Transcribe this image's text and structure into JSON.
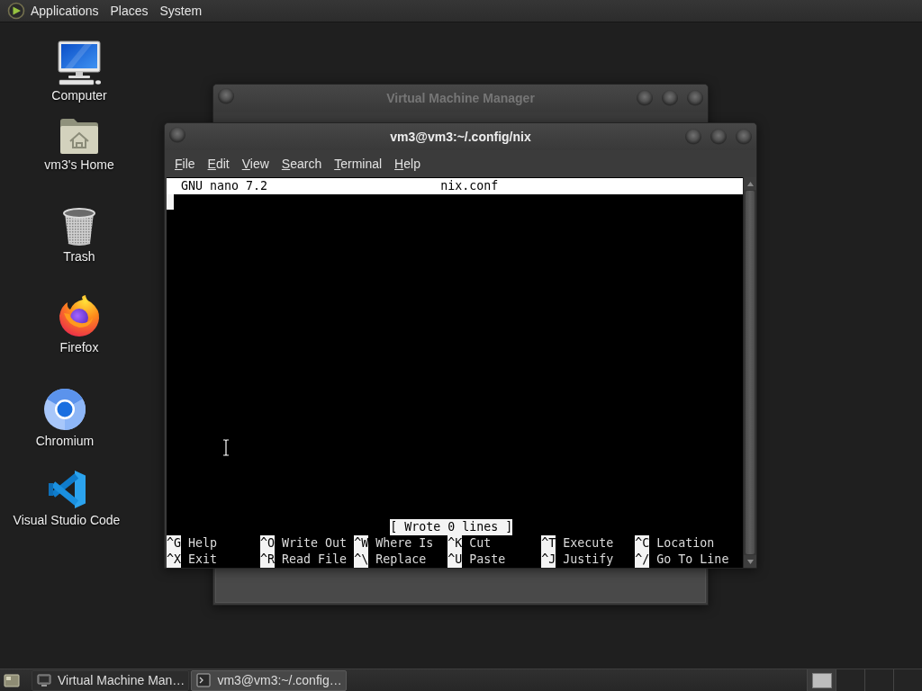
{
  "top_panel": {
    "menus": [
      "Applications",
      "Places",
      "System"
    ]
  },
  "desktop_icons": [
    {
      "kind": "computer",
      "label": "Computer"
    },
    {
      "kind": "home",
      "label": "vm3's Home"
    },
    {
      "kind": "trash",
      "label": "Trash"
    },
    {
      "kind": "firefox",
      "label": "Firefox"
    },
    {
      "kind": "chromium",
      "label": "Chromium"
    },
    {
      "kind": "vscode",
      "label": "Visual Studio Code"
    }
  ],
  "windows": [
    {
      "title": "Virtual Machine Manager",
      "focused": false
    },
    {
      "title": "vm3@vm3:~/.config/nix",
      "focused": true,
      "menus": [
        "File",
        "Edit",
        "View",
        "Search",
        "Terminal",
        "Help"
      ],
      "nano": {
        "version": "GNU nano 7.2",
        "filename": "nix.conf",
        "status": "[ Wrote 0 lines ]",
        "shortcut_rows": [
          [
            {
              "key": "^G",
              "label": "Help"
            },
            {
              "key": "^O",
              "label": "Write Out"
            },
            {
              "key": "^W",
              "label": "Where Is"
            },
            {
              "key": "^K",
              "label": "Cut"
            },
            {
              "key": "^T",
              "label": "Execute"
            },
            {
              "key": "^C",
              "label": "Location"
            }
          ],
          [
            {
              "key": "^X",
              "label": "Exit"
            },
            {
              "key": "^R",
              "label": "Read File"
            },
            {
              "key": "^\\",
              "label": "Replace"
            },
            {
              "key": "^U",
              "label": "Paste"
            },
            {
              "key": "^J",
              "label": "Justify"
            },
            {
              "key": "^/",
              "label": "Go To Line"
            }
          ]
        ]
      }
    }
  ],
  "taskbar": {
    "tasks": [
      {
        "kind": "vmm",
        "label": "Virtual Machine Man…",
        "selected": false
      },
      {
        "kind": "terminal",
        "label": "vm3@vm3:~/.config…",
        "selected": true
      }
    ],
    "workspaces": [
      {
        "selected": true
      },
      {
        "selected": false
      },
      {
        "selected": false
      },
      {
        "selected": false
      }
    ]
  }
}
